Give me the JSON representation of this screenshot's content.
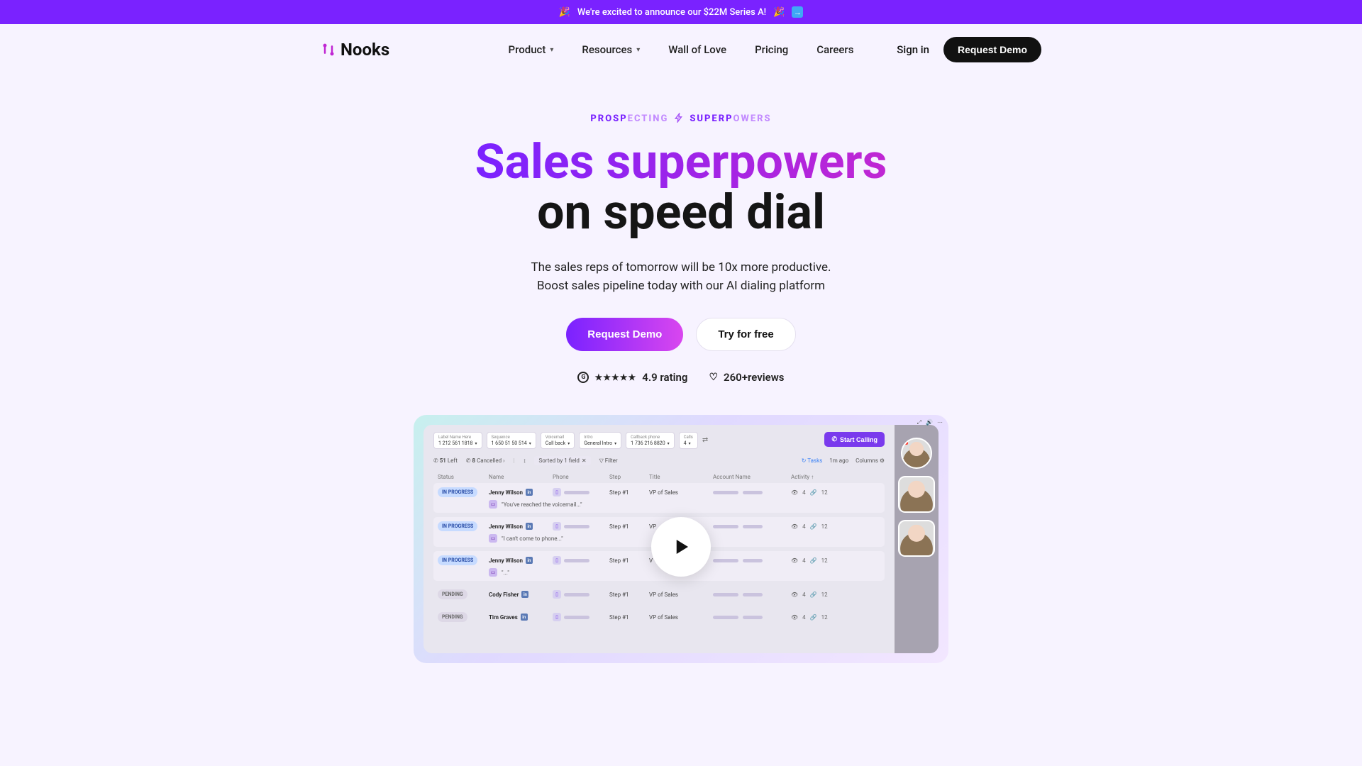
{
  "announce": {
    "emoji": "🎉",
    "text": "We're excited to announce our $22M Series A!",
    "arrow": "→"
  },
  "brand": {
    "name": "Nooks"
  },
  "nav": {
    "product": "Product",
    "resources": "Resources",
    "wall": "Wall of Love",
    "pricing": "Pricing",
    "careers": "Careers",
    "signin": "Sign in",
    "request_demo": "Request Demo"
  },
  "hero": {
    "tag_w1a": "PROSP",
    "tag_w1b": "ECTING",
    "tag_w2a": "SUPERP",
    "tag_w2b": "OWERS",
    "headline_top": "Sales superpowers",
    "headline_bottom": "on speed dial",
    "sub1": "The sales reps of tomorrow will be 10x more productive.",
    "sub2": "Boost sales pipeline today with our AI dialing platform",
    "cta_primary": "Request Demo",
    "cta_secondary": "Try for free",
    "rating_text": "4.9 rating",
    "reviews_text": "260+reviews"
  },
  "shot": {
    "start_calling": "Start Calling",
    "filters": {
      "label_name": {
        "lbl": "Label Name Here",
        "val": "1 212 561 1818"
      },
      "sequence": {
        "lbl": "Sequence",
        "val": "1 650 51 50 514"
      },
      "voicemail": {
        "lbl": "Voicemail",
        "val": "Call back"
      },
      "intro": {
        "lbl": "Intro",
        "val": "General Intro"
      },
      "callback": {
        "lbl": "Callback phone",
        "val": "1 736 216 8820"
      },
      "calls": {
        "lbl": "Calls",
        "val": "4"
      }
    },
    "toolbar": {
      "left_count": "51",
      "left_label": "Left",
      "cancelled_count": "8",
      "cancelled_label": "Cancelled",
      "sorted": "Sorted by 1 field",
      "filter": "Filter",
      "tasks": "Tasks",
      "time": "1m ago",
      "columns": "Columns"
    },
    "columns": {
      "status": "Status",
      "name": "Name",
      "phone": "Phone",
      "step": "Step",
      "title": "Title",
      "account": "Account Name",
      "activity": "Activity"
    },
    "rows": [
      {
        "status": "IN PROGRESS",
        "badge": "prog",
        "name": "Jenny Wilson",
        "step": "Step #1",
        "title": "VP of Sales",
        "views": "4",
        "links": "12",
        "sub": "\"You've reached  the voicemail...\""
      },
      {
        "status": "IN PROGRESS",
        "badge": "prog",
        "name": "Jenny Wilson",
        "step": "Step #1",
        "title": "VP",
        "views": "4",
        "links": "12",
        "sub": "\"I can't come to phone...\""
      },
      {
        "status": "IN PROGRESS",
        "badge": "prog",
        "name": "Jenny Wilson",
        "step": "Step #1",
        "title": "V",
        "views": "4",
        "links": "12",
        "sub": "\"...\""
      },
      {
        "status": "PENDING",
        "badge": "pend",
        "name": "Cody Fisher",
        "step": "Step #1",
        "title": "VP of Sales",
        "views": "4",
        "links": "12",
        "sub": null
      },
      {
        "status": "PENDING",
        "badge": "pend",
        "name": "Tim Graves",
        "step": "Step #1",
        "title": "VP of Sales",
        "views": "4",
        "links": "12",
        "sub": null
      }
    ]
  }
}
